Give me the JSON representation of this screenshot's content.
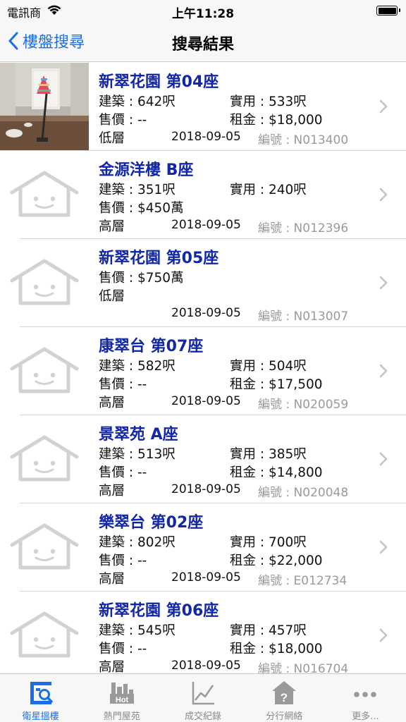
{
  "status_bar": {
    "carrier": "電訊商",
    "time": "上午11:28"
  },
  "nav": {
    "back_label": "樓盤搜尋",
    "title": "搜尋結果"
  },
  "labels": {
    "building": "建築 : ",
    "usable": "實用 : ",
    "sale": "售價 : ",
    "rent": "租金 : ",
    "code_prefix": "編號 : "
  },
  "listings": [
    {
      "name": "新翠花園 第04座",
      "building": "642呎",
      "usable": "533呎",
      "sale": "--",
      "rent": "$18,000",
      "floor": "低層",
      "date": "2018-09-05",
      "code": "N013400",
      "has_photo": true
    },
    {
      "name": "金源洋樓 B座",
      "building": "351呎",
      "usable": "240呎",
      "sale": "$450萬",
      "rent": null,
      "floor": "高層",
      "date": "2018-09-05",
      "code": "N012396",
      "has_photo": false
    },
    {
      "name": "新翠花園 第05座",
      "building": null,
      "usable": null,
      "sale": "$750萬",
      "rent": null,
      "floor": "低層",
      "date": "2018-09-05",
      "code": "N013007",
      "has_photo": false
    },
    {
      "name": "康翠台 第07座",
      "building": "582呎",
      "usable": "504呎",
      "sale": "--",
      "rent": "$17,500",
      "floor": "高層",
      "date": "2018-09-05",
      "code": "N020059",
      "has_photo": false
    },
    {
      "name": "景翠苑 A座",
      "building": "513呎",
      "usable": "385呎",
      "sale": "--",
      "rent": "$14,800",
      "floor": "高層",
      "date": "2018-09-05",
      "code": "N020048",
      "has_photo": false
    },
    {
      "name": "樂翠台 第02座",
      "building": "802呎",
      "usable": "700呎",
      "sale": "--",
      "rent": "$22,000",
      "floor": "高層",
      "date": "2018-09-05",
      "code": "E012734",
      "has_photo": false
    },
    {
      "name": "新翠花園 第06座",
      "building": "545呎",
      "usable": "457呎",
      "sale": "--",
      "rent": "$18,000",
      "floor": "高層",
      "date": "2018-09-05",
      "code": "N016704",
      "has_photo": false
    }
  ],
  "tabs": [
    {
      "label": "衛星搵樓",
      "icon": "satellite-search-icon",
      "active": true
    },
    {
      "label": "熱門屋苑",
      "icon": "hot-buildings-icon",
      "active": false
    },
    {
      "label": "成交紀錄",
      "icon": "line-chart-icon",
      "active": false
    },
    {
      "label": "分行網絡",
      "icon": "branch-house-icon",
      "active": false
    },
    {
      "label": "更多...",
      "icon": "more-dots-icon",
      "active": false
    }
  ],
  "colors": {
    "accent": "#1a6fe6",
    "title_blue": "#1227a8",
    "code_gray": "#9a9a9a",
    "tab_inactive": "#8a8a8a"
  }
}
